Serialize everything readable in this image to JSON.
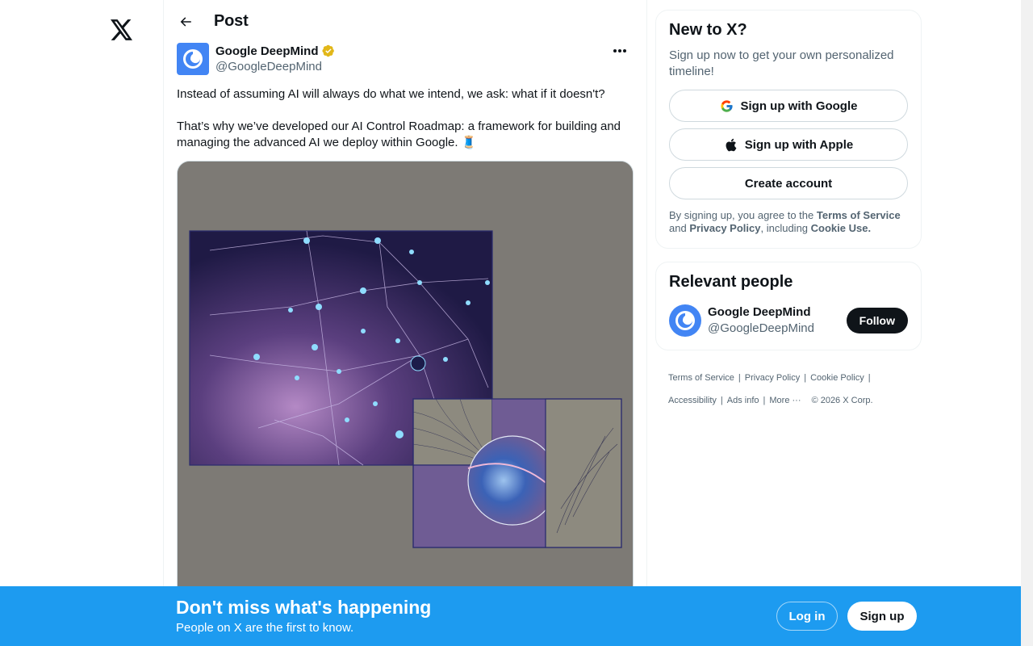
{
  "header": {
    "title": "Post"
  },
  "tweet": {
    "author_name": "Google DeepMind",
    "author_handle": "@GoogleDeepMind",
    "text": "Instead of assuming AI will always do what we intend, we ask: what if it doesn't?\n\nThat’s why we’ve developed our AI Control Roadmap: a framework for building and managing the advanced AI we deploy within Google. 🧵"
  },
  "signup_card": {
    "title": "New to X?",
    "subtitle": "Sign up now to get your own personalized timeline!",
    "google_label": "Sign up with Google",
    "apple_label": "Sign up with Apple",
    "create_label": "Create account",
    "legal_prefix": "By signing up, you agree to the ",
    "terms": "Terms of Service",
    "legal_and": " and ",
    "privacy": "Privacy Policy",
    "legal_including": ", including ",
    "cookie": "Cookie Use."
  },
  "people_card": {
    "title": "Relevant people",
    "person_name": "Google DeepMind",
    "person_handle": "@GoogleDeepMind",
    "follow_label": "Follow"
  },
  "footer": {
    "links": [
      "Terms of Service",
      "Privacy Policy",
      "Cookie Policy",
      "Accessibility",
      "Ads info",
      "More ···"
    ],
    "copyright": "© 2026 X Corp."
  },
  "bottom_bar": {
    "title": "Don't miss what's happening",
    "subtitle": "People on X are the first to know.",
    "login_label": "Log in",
    "signup_label": "Sign up"
  },
  "colors": {
    "accent": "#1d9bf0",
    "text": "#0f1419",
    "muted": "#536471",
    "verified_gold": "#e2b719"
  },
  "icons": [
    "x-logo-icon",
    "back-arrow-icon",
    "verified-badge-icon",
    "more-icon",
    "google-icon",
    "apple-icon"
  ]
}
